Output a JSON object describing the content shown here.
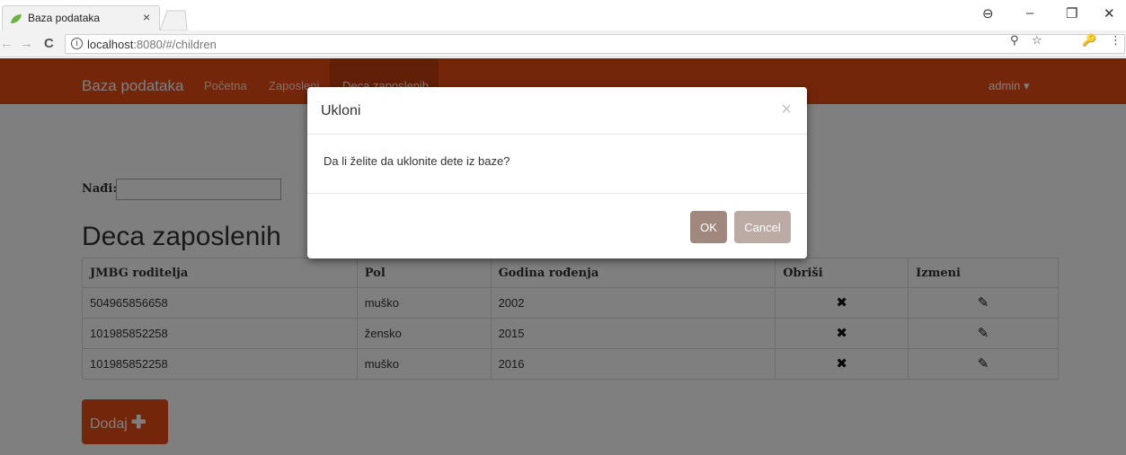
{
  "browser": {
    "tab_title": "Baza podataka",
    "tab_close": "×",
    "url_host": "localhost",
    "url_path": ":8080/#/children",
    "info_icon": "i",
    "window_controls": {
      "account": "⊖",
      "minimize": "–",
      "restore": "❐",
      "close": "✕"
    },
    "nav": {
      "back": "←",
      "forward": "→",
      "reload": "C"
    },
    "omni_icons": {
      "key": "⚲",
      "star": "☆",
      "ext": "🔑",
      "menu": "⋮"
    }
  },
  "navbar": {
    "brand": "Baza podataka",
    "links": [
      "Početna",
      "Zaposleni",
      "Deca zaposlenih"
    ],
    "user": "admin ▾",
    "colors": {
      "bar": "#e84c15",
      "active": "#c53f0f"
    }
  },
  "search": {
    "label": "Nađi:",
    "value": ""
  },
  "page_title": "Deca zaposlenih",
  "table": {
    "headers": [
      "JMBG roditelja",
      "Pol",
      "Godina rođenja",
      "Obriši",
      "Izmeni"
    ],
    "rows": [
      {
        "jmbg": "504965856658",
        "pol": "muško",
        "godina": "2002"
      },
      {
        "jmbg": "101985852258",
        "pol": "žensko",
        "godina": "2015"
      },
      {
        "jmbg": "101985852258",
        "pol": "muško",
        "godina": "2016"
      }
    ],
    "delete_icon": "✖",
    "edit_icon": "✎"
  },
  "add_button": {
    "label": "Dodaj",
    "icon": "✚"
  },
  "modal": {
    "title": "Ukloni",
    "close": "×",
    "message": "Da li želite da uklonite dete iz baze?",
    "ok_label": "OK",
    "cancel_label": "Cancel"
  }
}
